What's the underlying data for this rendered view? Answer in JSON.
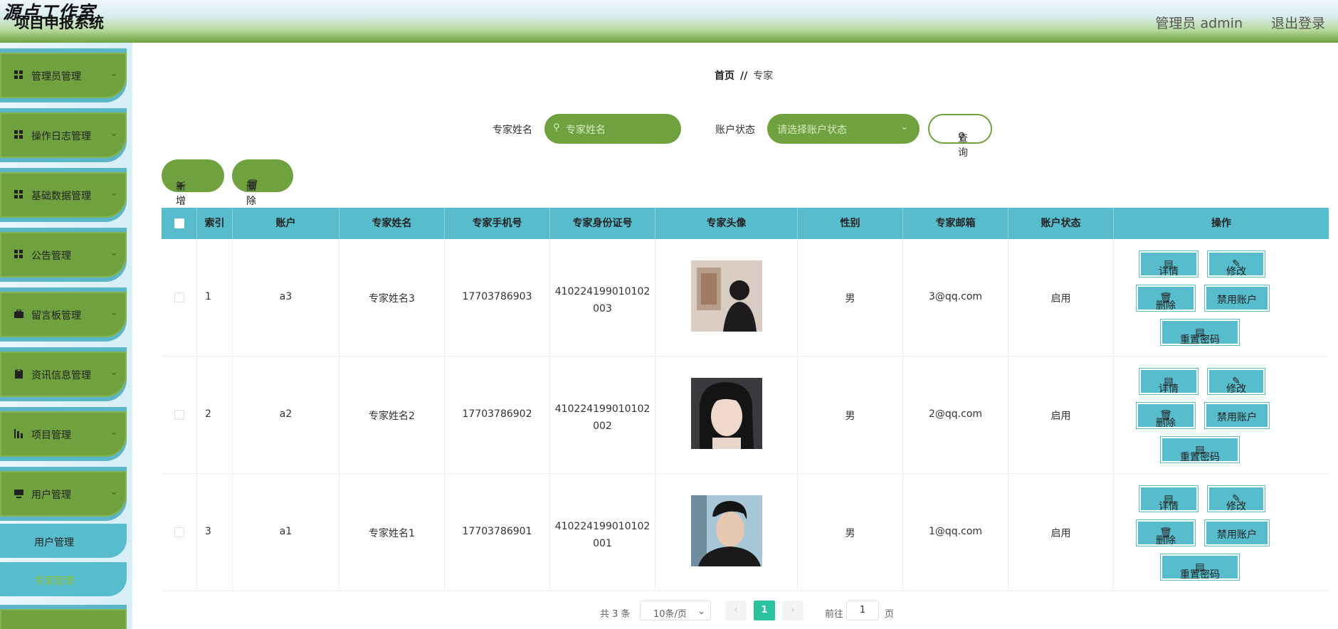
{
  "header": {
    "watermark": "源点工作室",
    "system_title": "项目申报系统",
    "user": "管理员 admin",
    "logout": "退出登录"
  },
  "sidebar": {
    "items": [
      {
        "label": "管理员管理",
        "icon": "grid-icon"
      },
      {
        "label": "操作日志管理",
        "icon": "grid-icon"
      },
      {
        "label": "基础数据管理",
        "icon": "grid-icon"
      },
      {
        "label": "公告管理",
        "icon": "grid-icon"
      },
      {
        "label": "留言板管理",
        "icon": "briefcase-icon"
      },
      {
        "label": "资讯信息管理",
        "icon": "clipboard-icon"
      },
      {
        "label": "项目管理",
        "icon": "chart-icon"
      },
      {
        "label": "用户管理",
        "icon": "monitor-icon"
      }
    ],
    "sub_items": [
      {
        "label": "用户管理"
      },
      {
        "label": "专家管理",
        "active": true
      }
    ]
  },
  "breadcrumb": {
    "home": "首页",
    "sep": "//",
    "current": "专家"
  },
  "search": {
    "name_label": "专家姓名",
    "name_placeholder": "专家姓名",
    "status_label": "账户状态",
    "status_placeholder": "请选择账户状态",
    "query_label": "查询"
  },
  "actions": {
    "add_label": "新增",
    "delete_label": "删除"
  },
  "table": {
    "headers": [
      "索引",
      "账户",
      "专家姓名",
      "专家手机号",
      "专家身份证号",
      "专家头像",
      "性别",
      "专家邮箱",
      "账户状态",
      "操作"
    ],
    "rows": [
      {
        "index": "1",
        "account": "a3",
        "name": "专家姓名3",
        "phone": "17703786903",
        "id_line1": "410224199010102",
        "id_line2": "003",
        "gender": "男",
        "email": "3@qq.com",
        "status": "启用"
      },
      {
        "index": "2",
        "account": "a2",
        "name": "专家姓名2",
        "phone": "17703786902",
        "id_line1": "410224199010102",
        "id_line2": "002",
        "gender": "男",
        "email": "2@qq.com",
        "status": "启用"
      },
      {
        "index": "3",
        "account": "a1",
        "name": "专家姓名1",
        "phone": "17703786901",
        "id_line1": "410224199010102",
        "id_line2": "001",
        "gender": "男",
        "email": "1@qq.com",
        "status": "启用"
      }
    ],
    "ops": {
      "detail": "详情",
      "edit": "修改",
      "delete": "删除",
      "disable": "禁用账户",
      "reset": "重置密码"
    }
  },
  "pagination": {
    "total": "共 3 条",
    "page_size": "10条/页",
    "current_page": "1",
    "goto_label": "前往",
    "goto_value": "1",
    "page_suffix": "页"
  },
  "colors": {
    "green": "#6fa23e",
    "teal": "#57bccb",
    "pager_active": "#2bc2a0"
  }
}
